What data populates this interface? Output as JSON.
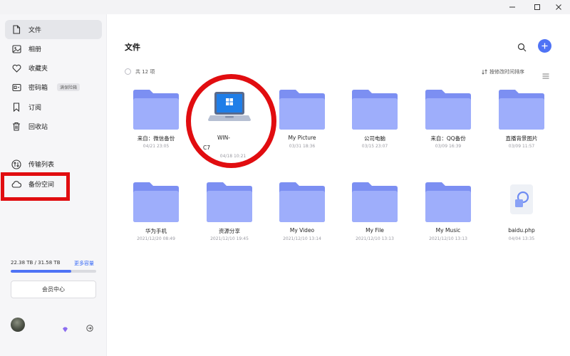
{
  "window": {
    "controls": [
      "minimize-icon",
      "maximize-icon",
      "close-icon"
    ]
  },
  "sidebar": {
    "items": [
      {
        "label": "文件",
        "icon": "file-icon",
        "active": true
      },
      {
        "label": "相册",
        "icon": "image-icon",
        "active": false
      },
      {
        "label": "收藏夹",
        "icon": "heart-icon",
        "active": false
      },
      {
        "label": "密码箱",
        "icon": "safe-icon",
        "active": false,
        "badge": "满保险箱"
      },
      {
        "label": "订阅",
        "icon": "bookmark-icon",
        "active": false
      },
      {
        "label": "回收站",
        "icon": "trash-icon",
        "active": false
      },
      {
        "label": "传输列表",
        "icon": "transfer-icon",
        "active": false
      },
      {
        "label": "备份空间",
        "icon": "cloud-icon",
        "active": false
      }
    ],
    "storage": {
      "text": "22.38 TB / 31.58 TB",
      "more": "更多容量",
      "used_fraction": 0.71
    },
    "vip_button": "会员中心"
  },
  "main": {
    "title": "文件",
    "count_text": "共 12 项",
    "sort_label": "按修改时间排序",
    "files": [
      {
        "name": "来自：微信备份",
        "date": "04/21 23:05",
        "type": "folder"
      },
      {
        "name_line1": "WIN-",
        "name_line2": "C7",
        "date": "04/18 10:21",
        "type": "pc"
      },
      {
        "name": "My Picture",
        "date": "03/31 18:36",
        "type": "folder"
      },
      {
        "name": "公司电脑",
        "date": "03/15 23:07",
        "type": "folder"
      },
      {
        "name": "来自：QQ备份",
        "date": "03/09 16:39",
        "type": "folder"
      },
      {
        "name": "直播背景图片",
        "date": "03/09 11:57",
        "type": "folder"
      },
      {
        "name": "华为手机",
        "date": "2021/12/20 08:49",
        "type": "folder"
      },
      {
        "name": "资源分享",
        "date": "2021/12/10 19:45",
        "type": "folder"
      },
      {
        "name": "My Video",
        "date": "2021/12/10 13:14",
        "type": "folder"
      },
      {
        "name": "My File",
        "date": "2021/12/10 13:13",
        "type": "folder"
      },
      {
        "name": "My Music",
        "date": "2021/12/10 13:13",
        "type": "folder"
      },
      {
        "name": "baidu.php",
        "date": "04/04 13:35",
        "type": "file"
      }
    ]
  },
  "colors": {
    "accent": "#4f73f5",
    "folder_back": "#7c8ff2",
    "folder_front": "#9eaefb",
    "annotation": "#e10d10"
  }
}
